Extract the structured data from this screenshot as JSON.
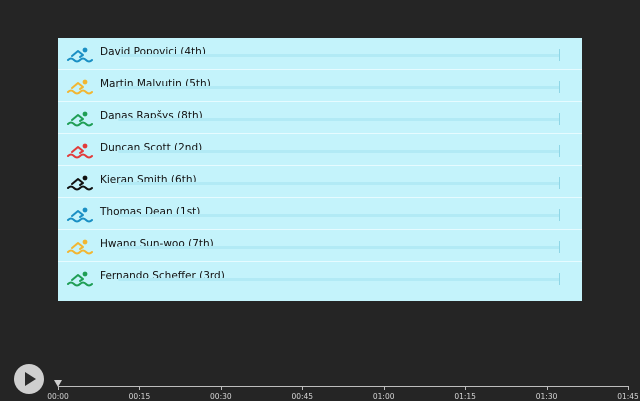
{
  "swimmers": [
    {
      "label": "David Popovici (4th)",
      "color": "#1a8fc4"
    },
    {
      "label": "Martin Malyutin (5th)",
      "color": "#f2b632"
    },
    {
      "label": "Danas Rapšys (8th)",
      "color": "#1f9e55"
    },
    {
      "label": "Duncan Scott (2nd)",
      "color": "#e23b3b"
    },
    {
      "label": "Kieran Smith (6th)",
      "color": "#111111"
    },
    {
      "label": "Thomas Dean (1st)",
      "color": "#1a8fc4"
    },
    {
      "label": "Hwang Sun-woo (7th)",
      "color": "#f2b632"
    },
    {
      "label": "Fernando Scheffer (3rd)",
      "color": "#1f9e55"
    }
  ],
  "timeline": {
    "ticks": [
      "00:00",
      "00:15",
      "00:30",
      "00:45",
      "01:00",
      "01:15",
      "01:30",
      "01:45"
    ],
    "progress": 0
  }
}
